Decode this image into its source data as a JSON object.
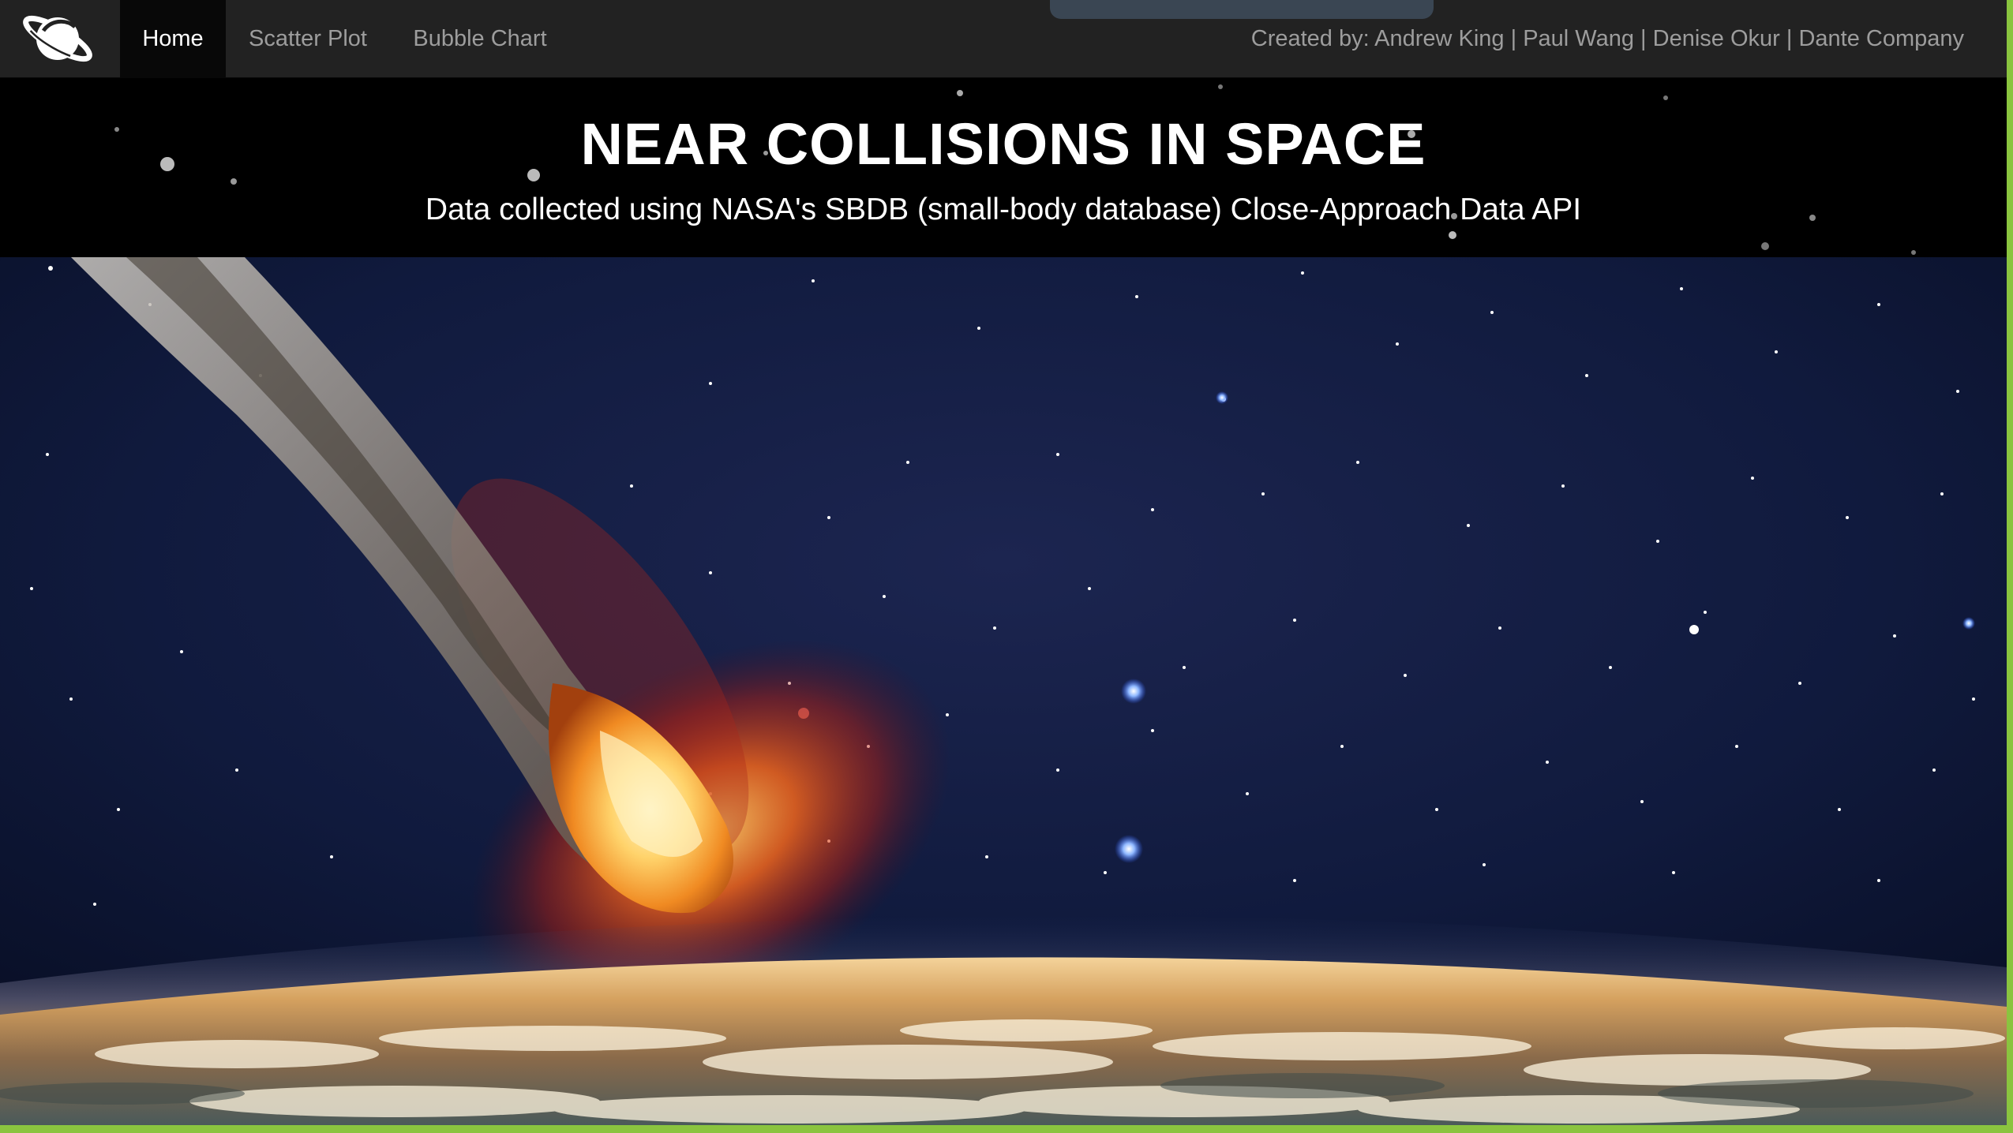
{
  "navbar": {
    "brand_icon": "planet-saturn-icon",
    "items": [
      {
        "label": "Home",
        "active": true
      },
      {
        "label": "Scatter Plot",
        "active": false
      },
      {
        "label": "Bubble Chart",
        "active": false
      }
    ],
    "credits": "Created by: Andrew King | Paul Wang | Denise Okur | Dante Company"
  },
  "header": {
    "title": "NEAR COLLISIONS IN SPACE",
    "subtitle": "Data collected using NASA's SBDB (small-body database) Close-Approach Data API"
  },
  "hero": {
    "image_subject": "meteor-over-earth-illustration"
  },
  "colors": {
    "navbar_bg": "#222222",
    "nav_active_bg": "#080808",
    "nav_text": "#9d9d9d",
    "nav_active_text": "#ffffff",
    "header_bg": "#000000",
    "frame_border": "#8ac43f"
  }
}
